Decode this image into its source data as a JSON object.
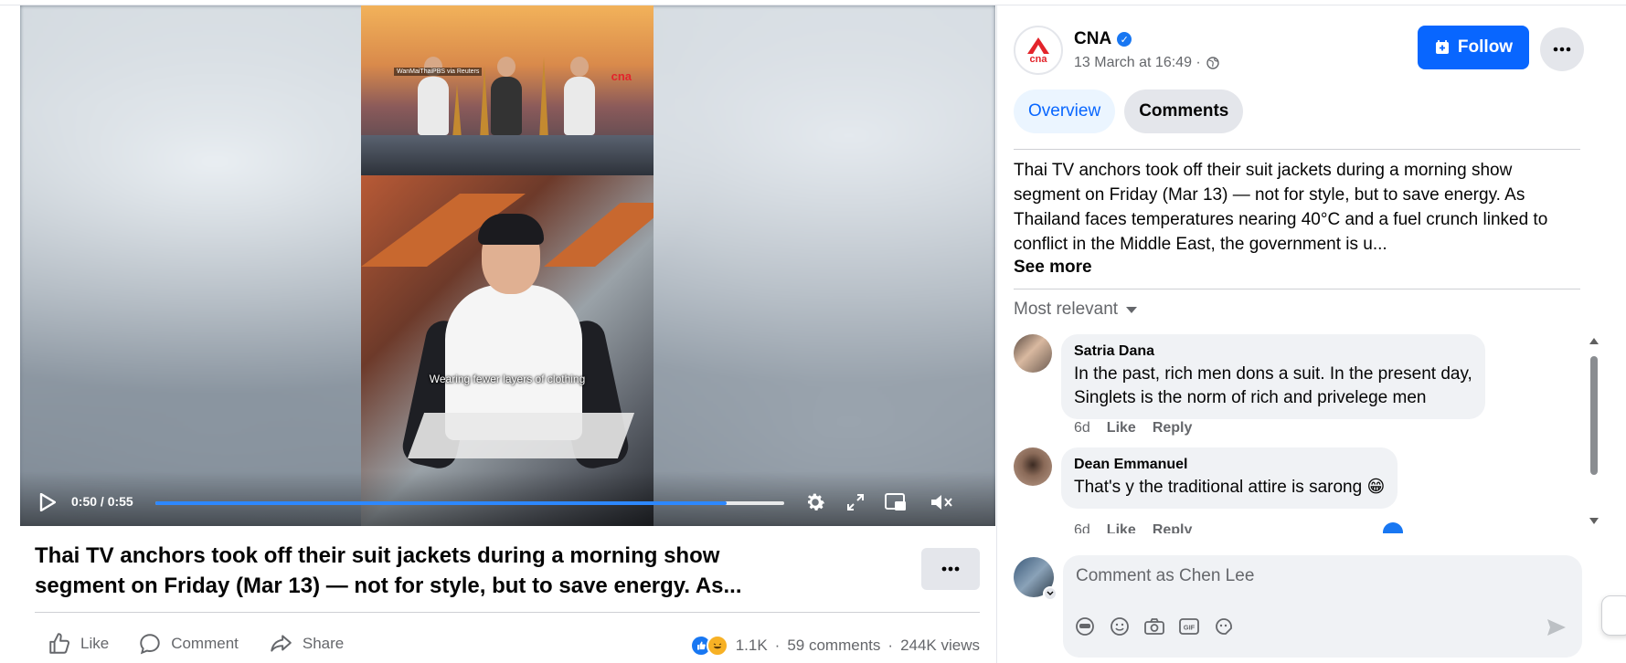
{
  "video": {
    "time": "0:50 / 0:55",
    "progress_fraction": 0.909,
    "subtitle": "Wearing fewer layers of clothing",
    "credit": "WanMaiThaiPBS via Reuters",
    "watermark": "cna",
    "icons": [
      "play-icon",
      "settings-icon",
      "fullscreen-icon",
      "pip-icon",
      "mute-icon"
    ]
  },
  "post": {
    "title_line1": "Thai TV anchors took off their suit jackets during a morning show",
    "title_line2": "segment on Friday (Mar 13) — not for style, but to save energy. As...",
    "actions": {
      "like": "Like",
      "comment": "Comment",
      "share": "Share"
    },
    "stats": {
      "reactions": "1.1K",
      "comments": "59 comments",
      "views": "244K views"
    }
  },
  "page": {
    "name": "CNA",
    "time": "13 March at 16:49 ·",
    "follow_label": "Follow"
  },
  "tabs": [
    {
      "label": "Overview",
      "active": true
    },
    {
      "label": "Comments",
      "active": false
    }
  ],
  "description": {
    "line1": "Thai TV anchors took off their suit jackets during a morning show",
    "line2": "segment on Friday (Mar 13) — not for style, but to save energy. As",
    "line3": "Thailand faces temperatures nearing 40°C and a fuel crunch linked to",
    "line4": "conflict in the Middle East, the government is u...",
    "see_more": "See more"
  },
  "sort_label": "Most relevant",
  "comments": [
    {
      "author": "Satria Dana",
      "line1": "In the past, rich men dons a suit. In the present day,",
      "line2": "Singlets is the norm of rich and privelege men",
      "age": "6d",
      "like": "Like",
      "reply": "Reply"
    },
    {
      "author": "Dean Emmanuel",
      "line1": "That's y the traditional attire is sarong 😁",
      "age": "6d",
      "like": "Like",
      "reply": "Reply"
    }
  ],
  "composer": {
    "placeholder": "Comment as Chen Lee",
    "icons": [
      "avatar-sticker-icon",
      "emoji-icon",
      "camera-icon",
      "gif-icon",
      "sticker-icon"
    ]
  },
  "colors": {
    "accent": "#0866ff",
    "progress": "#2d88ff",
    "text_secondary": "#65676b"
  }
}
